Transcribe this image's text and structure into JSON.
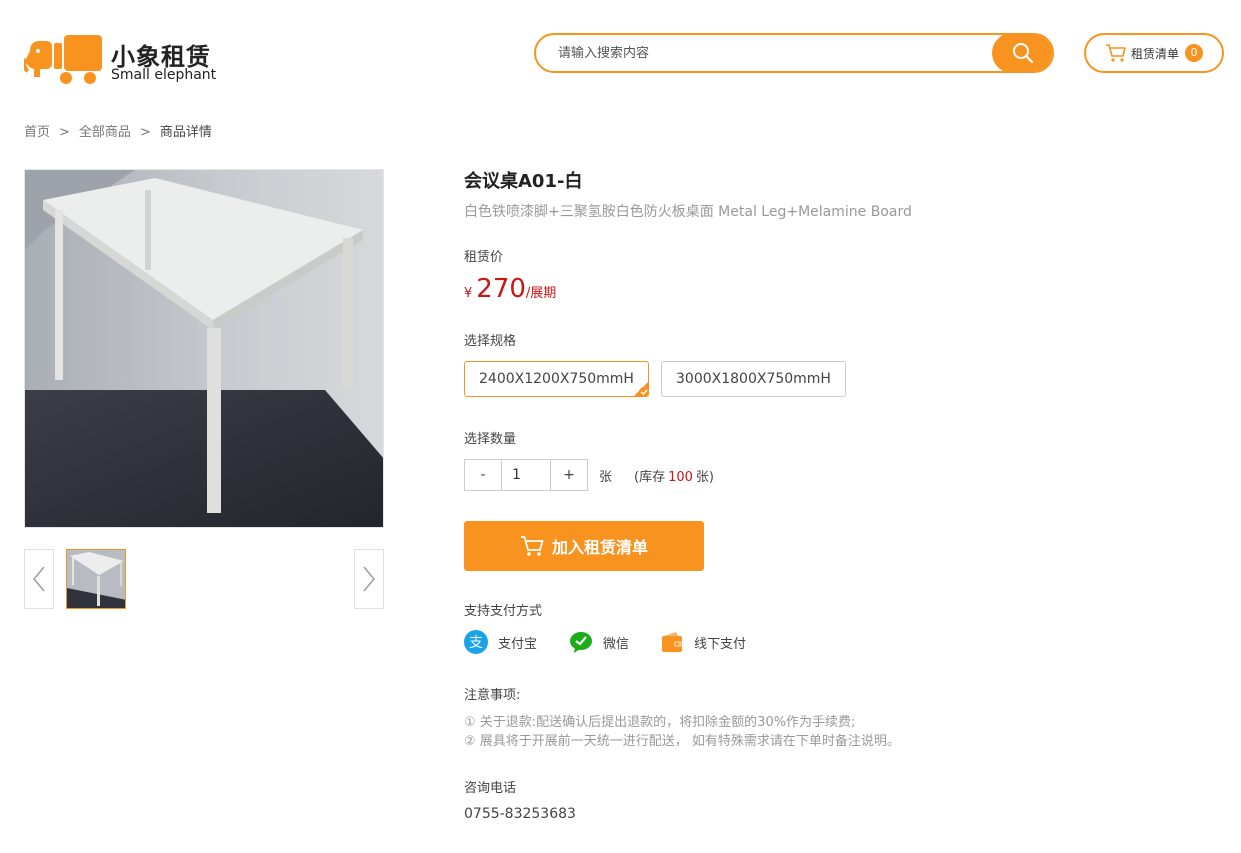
{
  "brand": {
    "name_cn": "小象租赁",
    "name_en": "Small elephant",
    "color": "#f7931e"
  },
  "search": {
    "placeholder": "请输入搜索内容",
    "icon": "search-icon"
  },
  "cart": {
    "label": "租赁清单",
    "count": "0",
    "icon": "cart-icon"
  },
  "breadcrumb": {
    "items": [
      "首页",
      "全部商品",
      "商品详情"
    ],
    "separator": ">"
  },
  "gallery": {
    "prev_icon": "chevron-left-icon",
    "next_icon": "chevron-right-icon",
    "thumbnails": 1
  },
  "product": {
    "title": "会议桌A01-白",
    "subtitle": "白色铁喷漆脚+三聚氢胺白色防火板桌面 Metal Leg+Melamine Board",
    "price_label": "租赁价",
    "price_currency": "¥",
    "price_value": "270",
    "price_unit": "/展期",
    "spec_label": "选择规格",
    "specs": [
      "2400X1200X750mmH",
      "3000X1800X750mmH"
    ],
    "selected_spec": "2400X1200X750mmH",
    "qty_label": "选择数量",
    "qty_minus": "-",
    "qty_plus": "+",
    "qty_value": "1",
    "qty_unit": "张",
    "stock_prefix": "(库存",
    "stock_value": "100",
    "stock_suffix": "张)",
    "add_button": "加入租赁清单"
  },
  "payment": {
    "label": "支持支付方式",
    "methods": [
      {
        "name": "支付宝",
        "icon": "alipay-icon",
        "color": "#1aa3e8"
      },
      {
        "name": "微信",
        "icon": "wechat-icon",
        "color": "#1aad19"
      },
      {
        "name": "线下支付",
        "icon": "wallet-icon",
        "color": "#f7931e"
      }
    ]
  },
  "notes": {
    "label": "注意事项:",
    "lines": [
      "① 关于退款:配送确认后提出退款的，将扣除金额的30%作为手续费;",
      "② 展具将于开展前一天统一进行配送， 如有特殊需求请在下单时备注说明。"
    ]
  },
  "contact": {
    "label": "咨询电话",
    "phone": "0755-83253683"
  },
  "colors": {
    "accent": "#f7931e",
    "price": "#c91616",
    "muted": "#999999"
  }
}
